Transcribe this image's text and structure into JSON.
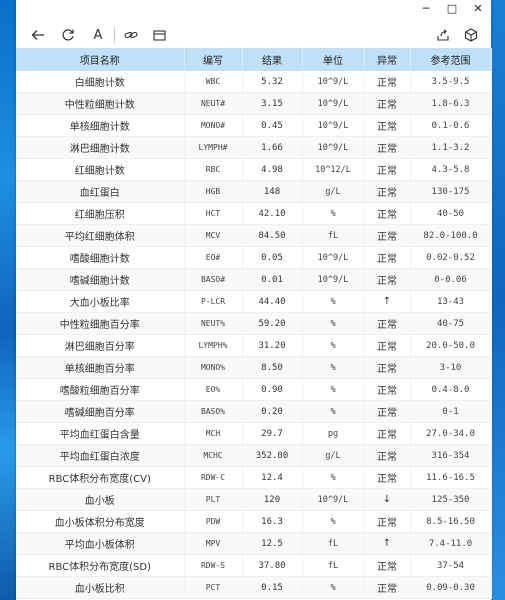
{
  "window": {
    "controls": {
      "minimize": "─",
      "maximize": "□",
      "close": "✕"
    }
  },
  "toolbar": {
    "icons": [
      "back-arrow-icon",
      "refresh-icon",
      "text-icon",
      "link-icon",
      "panel-icon",
      "share-icon",
      "cube-icon"
    ],
    "text_icon_glyph": "A"
  },
  "table": {
    "headers": [
      "项目名称",
      "编写",
      "结果",
      "单位",
      "异常",
      "参考范围"
    ],
    "rows": [
      [
        "白细胞计数",
        "WBC",
        "5.32",
        "10^9/L",
        "正常",
        "3.5-9.5"
      ],
      [
        "中性粒细胞计数",
        "NEUT#",
        "3.15",
        "10^9/L",
        "正常",
        "1.8-6.3"
      ],
      [
        "单核细胞计数",
        "MONO#",
        "0.45",
        "10^9/L",
        "正常",
        "0.1-0.6"
      ],
      [
        "淋巴细胞计数",
        "LYMPH#",
        "1.66",
        "10^9/L",
        "正常",
        "1.1-3.2"
      ],
      [
        "红细胞计数",
        "RBC",
        "4.98",
        "10^12/L",
        "正常",
        "4.3-5.8"
      ],
      [
        "血红蛋白",
        "HGB",
        "148",
        "g/L",
        "正常",
        "130-175"
      ],
      [
        "红细胞压积",
        "HCT",
        "42.10",
        "%",
        "正常",
        "40-50"
      ],
      [
        "平均红细胞体积",
        "MCV",
        "84.50",
        "fL",
        "正常",
        "82.0-100.0"
      ],
      [
        "嗜酸细胞计数",
        "EO#",
        "0.05",
        "10^9/L",
        "正常",
        "0.02-0.52"
      ],
      [
        "嗜碱细胞计数",
        "BASO#",
        "0.01",
        "10^9/L",
        "正常",
        "0-0.06"
      ],
      [
        "大血小板比率",
        "P-LCR",
        "44.40",
        "%",
        "↑",
        "13-43"
      ],
      [
        "中性粒细胞百分率",
        "NEUT%",
        "59.20",
        "%",
        "正常",
        "40-75"
      ],
      [
        "淋巴细胞百分率",
        "LYMPH%",
        "31.20",
        "%",
        "正常",
        "20.0-50.0"
      ],
      [
        "单核细胞百分率",
        "MONO%",
        "8.50",
        "%",
        "正常",
        "3-10"
      ],
      [
        "嗜酸粒细胞百分率",
        "EO%",
        "0.90",
        "%",
        "正常",
        "0.4-8.0"
      ],
      [
        "嗜碱细胞百分率",
        "BASO%",
        "0.20",
        "%",
        "正常",
        "0-1"
      ],
      [
        "平均血红蛋白含量",
        "MCH",
        "29.7",
        "pg",
        "正常",
        "27.0-34.0"
      ],
      [
        "平均血红蛋白浓度",
        "MCHC",
        "352.00",
        "g/L",
        "正常",
        "316-354"
      ],
      [
        "RBC体积分布宽度(CV)",
        "RDW-C",
        "12.4",
        "%",
        "正常",
        "11.6-16.5"
      ],
      [
        "血小板",
        "PLT",
        "120",
        "10^9/L",
        "↓",
        "125-350"
      ],
      [
        "血小板体积分布宽度",
        "PDW",
        "16.3",
        "%",
        "正常",
        "8.5-16.50"
      ],
      [
        "平均血小板体积",
        "MPV",
        "12.5",
        "fL",
        "↑",
        "7.4-11.0"
      ],
      [
        "RBC体积分布宽度(SD)",
        "RDW-S",
        "37.80",
        "fL",
        "正常",
        "37-54"
      ],
      [
        "血小板比积",
        "PCT",
        "0.15",
        "%",
        "正常",
        "0.09-0.30"
      ]
    ]
  }
}
